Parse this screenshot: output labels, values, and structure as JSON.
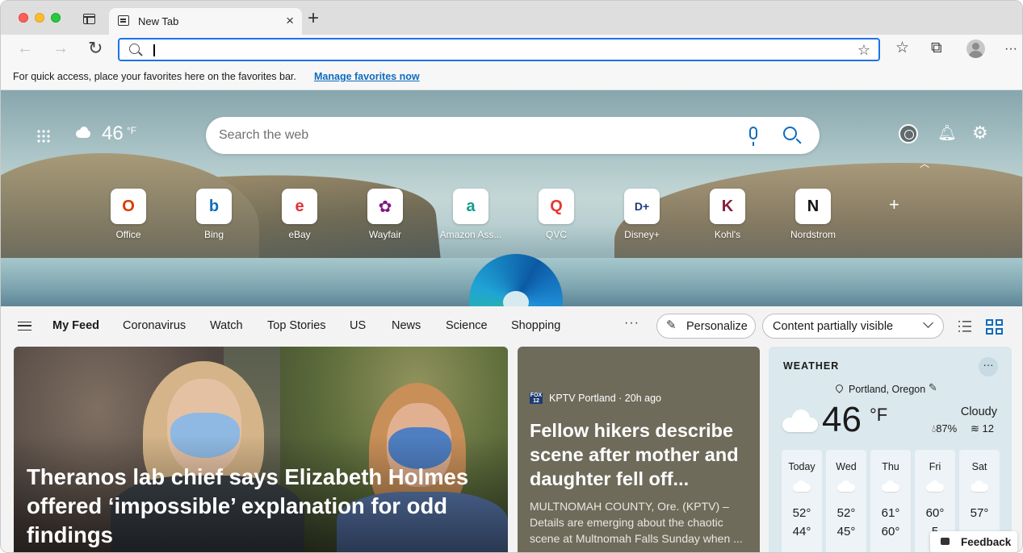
{
  "browser": {
    "tab_title": "New Tab",
    "address_value": "",
    "favorites_bar_text": "For quick access, place your favorites here on the favorites bar.",
    "favorites_bar_link": "Manage favorites now"
  },
  "hero": {
    "temperature": "46",
    "temperature_unit": "°F",
    "search_placeholder": "Search the web",
    "quick_links": [
      {
        "label": "Office",
        "glyph": "O",
        "color": "#d83b01"
      },
      {
        "label": "Bing",
        "glyph": "b",
        "color": "#0f6cbd"
      },
      {
        "label": "eBay",
        "glyph": "e",
        "color": "#e53238"
      },
      {
        "label": "Wayfair",
        "glyph": "✿",
        "color": "#7f187f"
      },
      {
        "label": "Amazon Ass...",
        "glyph": "a",
        "color": "#0f9d8a"
      },
      {
        "label": "QVC",
        "glyph": "Q",
        "color": "#e53935"
      },
      {
        "label": "Disney+",
        "glyph": "D+",
        "color": "#1a3a7a"
      },
      {
        "label": "Kohl's",
        "glyph": "K",
        "color": "#8a1c3b"
      },
      {
        "label": "Nordstrom",
        "glyph": "N",
        "color": "#111111"
      }
    ]
  },
  "feed_nav": {
    "tabs": [
      "My Feed",
      "Coronavirus",
      "Watch",
      "Top Stories",
      "US",
      "News",
      "Science",
      "Shopping"
    ],
    "more": "···",
    "personalize": "Personalize",
    "content_visibility": "Content partially visible"
  },
  "main_story": {
    "headline": "Theranos lab chief says Elizabeth Holmes offered ‘impossible’ explanation for odd findings"
  },
  "second_story": {
    "source": "KPTV Portland · 20h ago",
    "source_logo": "FOX 12",
    "headline": "Fellow hikers describe scene after mother and daughter fell off...",
    "summary": "MULTNOMAH COUNTY, Ore. (KPTV) – Details are emerging about the chaotic scene at Multnomah Falls Sunday when ..."
  },
  "weather": {
    "title": "WEATHER",
    "more": "···",
    "location": "Portland, Oregon",
    "temperature": "46",
    "unit": "°F",
    "condition": "Cloudy",
    "humidity": "87%",
    "wind": "12",
    "forecast": [
      {
        "day": "Today",
        "high": "52°",
        "low": "44°"
      },
      {
        "day": "Wed",
        "high": "52°",
        "low": "45°"
      },
      {
        "day": "Thu",
        "high": "61°",
        "low": "60°"
      },
      {
        "day": "Fri",
        "high": "60°",
        "low": "5"
      },
      {
        "day": "Sat",
        "high": "57°",
        "low": ""
      }
    ]
  },
  "feedback": "Feedback",
  "colors": {
    "accent": "#0f6cbd",
    "address_focus": "#1a73e8"
  }
}
